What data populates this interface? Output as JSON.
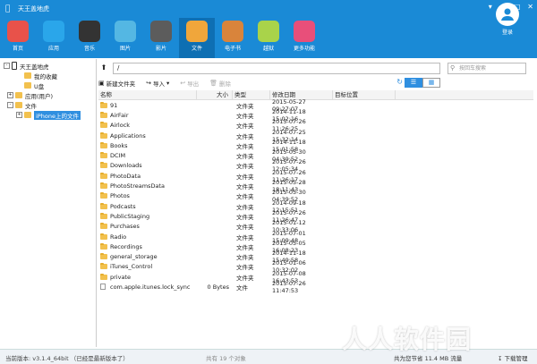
{
  "window": {
    "title": "天王盖地虎",
    "apple_icon": "apple-icon"
  },
  "toolbar": {
    "items": [
      {
        "label": "首页",
        "icon": "home-icon",
        "color": "#e8524a"
      },
      {
        "label": "应用",
        "icon": "apps-icon",
        "color": "#2aa6ea"
      },
      {
        "label": "音乐",
        "icon": "music-icon",
        "color": "#333333"
      },
      {
        "label": "图片",
        "icon": "photos-icon",
        "color": "#54b7e3"
      },
      {
        "label": "影片",
        "icon": "video-icon",
        "color": "#5c5c5c"
      },
      {
        "label": "文件",
        "icon": "files-icon",
        "color": "#f0a63b"
      },
      {
        "label": "电子书",
        "icon": "ebook-icon",
        "color": "#d9843b"
      },
      {
        "label": "越狱",
        "icon": "jailbreak-icon",
        "color": "#a9d34a"
      },
      {
        "label": "更多功能",
        "icon": "more-icon",
        "color": "#e84f7a"
      }
    ],
    "active_index": 5,
    "login_label": "登录"
  },
  "tree": {
    "root": "天王盖地虎",
    "items": [
      {
        "label": "我的收藏",
        "level": 1,
        "expander": ""
      },
      {
        "label": "U盘",
        "level": 1,
        "expander": ""
      },
      {
        "label": "应用(用户)",
        "level": 0,
        "expander": "+"
      },
      {
        "label": "文件",
        "level": 0,
        "expander": "-"
      },
      {
        "label": "iPhone上的文件",
        "level": 1,
        "expander": "+",
        "selected": true
      }
    ]
  },
  "address": {
    "path": "/",
    "search_placeholder": "按回车搜索"
  },
  "actions": {
    "new_folder": "新建文件夹",
    "import": "导入",
    "export": "导出",
    "delete": "删除"
  },
  "columns": {
    "name": "名称",
    "size": "大小",
    "type": "类型",
    "date": "修改日期",
    "location": "目标位置"
  },
  "files": [
    {
      "name": "91",
      "size": "",
      "type": "文件夹",
      "date": "2015-05-27 09:27:07",
      "kind": "folder"
    },
    {
      "name": "AirFair",
      "size": "",
      "type": "文件夹",
      "date": "2014-11-18 15:02:16",
      "kind": "folder"
    },
    {
      "name": "Airlock",
      "size": "",
      "type": "文件夹",
      "date": "2015-07-26 11:26:25",
      "kind": "folder"
    },
    {
      "name": "Applications",
      "size": "",
      "type": "文件夹",
      "date": "2014-07-25 15:32:14",
      "kind": "folder"
    },
    {
      "name": "Books",
      "size": "",
      "type": "文件夹",
      "date": "2014-11-18 15:01:58",
      "kind": "folder"
    },
    {
      "name": "DCIM",
      "size": "",
      "type": "文件夹",
      "date": "2015-05-30 04:39:52",
      "kind": "folder"
    },
    {
      "name": "Downloads",
      "size": "",
      "type": "文件夹",
      "date": "2015-07-26 12:05:34",
      "kind": "folder"
    },
    {
      "name": "PhotoData",
      "size": "",
      "type": "文件夹",
      "date": "2015-07-26 11:26:17",
      "kind": "folder"
    },
    {
      "name": "PhotoStreamsData",
      "size": "",
      "type": "文件夹",
      "date": "2015-05-28 18:11:43",
      "kind": "folder"
    },
    {
      "name": "Photos",
      "size": "",
      "type": "文件夹",
      "date": "2015-05-30 04:39:52",
      "kind": "folder"
    },
    {
      "name": "Podcasts",
      "size": "",
      "type": "文件夹",
      "date": "2014-09-18 12:15:51",
      "kind": "folder"
    },
    {
      "name": "PublicStaging",
      "size": "",
      "type": "文件夹",
      "date": "2015-07-26 11:26:47",
      "kind": "folder"
    },
    {
      "name": "Purchases",
      "size": "",
      "type": "文件夹",
      "date": "2015-01-12 10:33:06",
      "kind": "folder"
    },
    {
      "name": "Radio",
      "size": "",
      "type": "文件夹",
      "date": "2015-07-01 15:09:48",
      "kind": "folder"
    },
    {
      "name": "Recordings",
      "size": "",
      "type": "文件夹",
      "date": "2015-05-05 16:08:23",
      "kind": "folder"
    },
    {
      "name": "general_storage",
      "size": "",
      "type": "文件夹",
      "date": "2014-11-18 15:49:58",
      "kind": "folder"
    },
    {
      "name": "iTunes_Control",
      "size": "",
      "type": "文件夹",
      "date": "2015-01-06 10:32:02",
      "kind": "folder"
    },
    {
      "name": "private",
      "size": "",
      "type": "文件夹",
      "date": "2015-07-08 16:43:53",
      "kind": "folder"
    },
    {
      "name": "com.apple.itunes.lock_sync",
      "size": "0 Bytes",
      "type": "文件",
      "date": "2015-07-26 11:47:53",
      "kind": "file"
    }
  ],
  "status": {
    "version": "当前版本: v3.1.4_64bit （已经是最新版本了）",
    "count": "共有 19 个对象",
    "network": "共为您节省  11.4 MB 流量",
    "download_manager": "下载管理"
  },
  "watermark": "人人软件园"
}
